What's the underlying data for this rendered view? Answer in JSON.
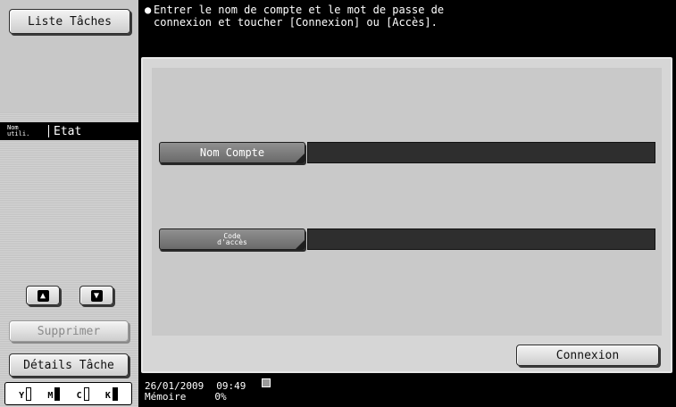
{
  "sidebar": {
    "job_list_button": "Liste Tâches",
    "col_user_label": "Nom\nutili.",
    "col_status_label": "Etat",
    "delete_button": "Supprimer",
    "job_details_button": "Détails Tâche",
    "toner": [
      {
        "letter": "Y",
        "state": "empty"
      },
      {
        "letter": "M",
        "state": "full"
      },
      {
        "letter": "C",
        "state": "empty"
      },
      {
        "letter": "K",
        "state": "full"
      }
    ]
  },
  "message": {
    "line1": "Entrer le nom de compte et le mot de passe de",
    "line2": "connexion et toucher [Connexion] ou [Accès]."
  },
  "form": {
    "account_label": "Nom Compte",
    "account_value": "",
    "password_label": "Code\nd'accès",
    "password_value": "",
    "login_button": "Connexion"
  },
  "status": {
    "date": "26/01/2009",
    "time": "09:49",
    "memory_label": "Mémoire",
    "memory_value": "0%"
  }
}
